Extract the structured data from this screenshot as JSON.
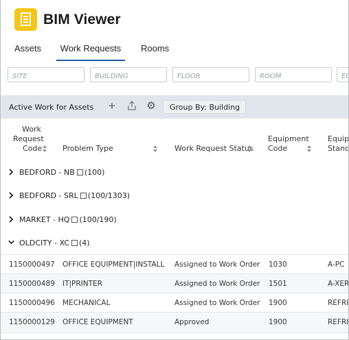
{
  "app": {
    "title": "BIM Viewer",
    "logo_icon": "document-icon",
    "accent_color": "#f5c518"
  },
  "tabs": [
    {
      "label": "Assets",
      "active": false
    },
    {
      "label": "Work Requests",
      "active": true
    },
    {
      "label": "Rooms",
      "active": false
    }
  ],
  "filters": [
    {
      "placeholder": "SITE"
    },
    {
      "placeholder": "BUILDING"
    },
    {
      "placeholder": "FLOOR"
    },
    {
      "placeholder": "ROOM"
    },
    {
      "placeholder": "EQ"
    }
  ],
  "toolbar": {
    "title": "Active Work for Assets",
    "add_icon": "plus-icon",
    "export_icon": "export-icon",
    "settings_icon": "gear-icon",
    "group_by_label": "Group By: Building"
  },
  "columns": {
    "code_line1": "Work",
    "code_line2": "Request",
    "code_line3": "Code",
    "problem_type": "Problem Type",
    "status": "Work Request Status",
    "equip_line1": "Equipment",
    "equip_line2": "Code",
    "std_line1": "Equip",
    "std_line2": "Stand"
  },
  "groups": [
    {
      "name": "BEDFORD - NB",
      "count": "(100)",
      "expanded": false
    },
    {
      "name": "BEDFORD - SRL",
      "count": "(100/1303)",
      "expanded": false
    },
    {
      "name": "MARKET - HQ",
      "count": "(100/190)",
      "expanded": false
    },
    {
      "name": "OLDCITY - XC",
      "count": "(4)",
      "expanded": true
    }
  ],
  "rows": [
    {
      "code": "1150000497",
      "problem_type": "OFFICE EQUIPMENT|INSTALL",
      "status": "Assigned to Work Order",
      "equipment": "1030",
      "standard": "A-PC"
    },
    {
      "code": "1150000489",
      "problem_type": "IT|PRINTER",
      "status": "Assigned to Work Order",
      "equipment": "1501",
      "standard": "A-XEROX"
    },
    {
      "code": "1150000496",
      "problem_type": "MECHANICAL",
      "status": "Assigned to Work Order",
      "equipment": "1900",
      "standard": "REFRIG"
    },
    {
      "code": "1150000129",
      "problem_type": "OFFICE EQUIPMENT",
      "status": "Approved",
      "equipment": "1900",
      "standard": "REFRIG"
    }
  ]
}
